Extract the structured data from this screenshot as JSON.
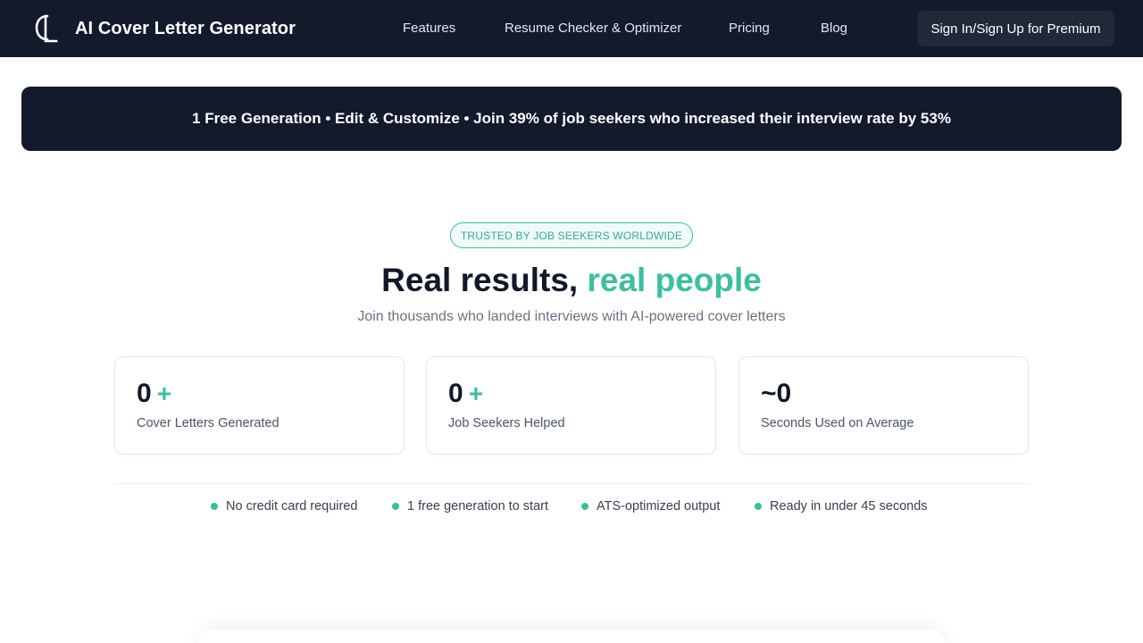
{
  "header": {
    "brand": "AI Cover Letter Generator",
    "nav": [
      "Features",
      "Resume Checker & Optimizer",
      "Pricing",
      "Blog"
    ],
    "signin_label": "Sign In/Sign Up for Premium"
  },
  "banner": {
    "text": "1 Free Generation • Edit & Customize • Join 39% of job seekers who increased their interview rate by 53%"
  },
  "hero": {
    "badge": "TRUSTED BY JOB SEEKERS WORLDWIDE",
    "headline_main": "Real results,",
    "headline_accent": "real people",
    "subheadline": "Join thousands who landed interviews with AI-powered cover letters"
  },
  "stats": [
    {
      "value": "0",
      "suffix": "+",
      "label": "Cover Letters Generated"
    },
    {
      "value": "0",
      "suffix": "+",
      "label": "Job Seekers Helped"
    },
    {
      "value": "~0",
      "suffix": "",
      "label": "Seconds Used on Average"
    }
  ],
  "features": [
    "No credit card required",
    "1 free generation to start",
    "ATS-optimized output",
    "Ready in under 45 seconds"
  ],
  "colors": {
    "header_bg": "#121a2c",
    "accent": "#3bbf9f"
  }
}
